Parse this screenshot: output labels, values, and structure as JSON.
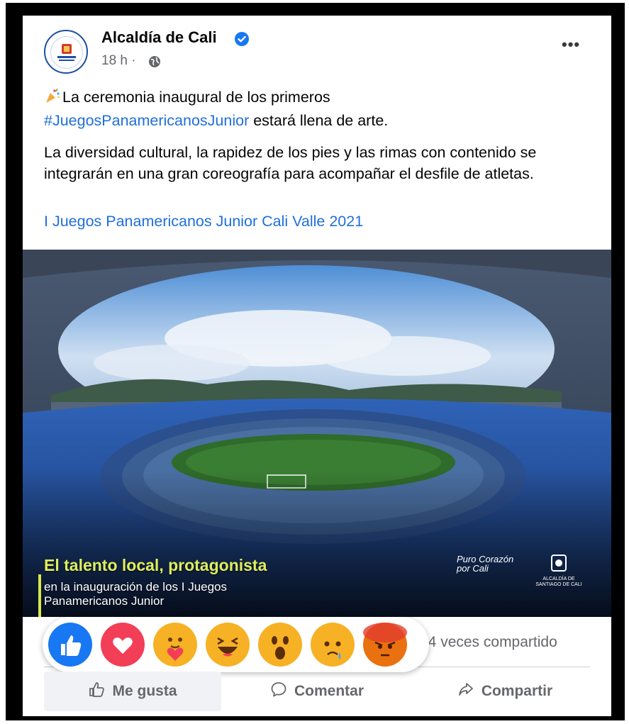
{
  "post": {
    "page_name": "Alcaldía de Cali",
    "time": "18 h ·",
    "more": "•••",
    "text_line1_prefix": "La ceremonia inaugural de los primeros",
    "hashtag": "#JuegosPanamericanosJunior",
    "text_line2_suffix": " estará llena de arte.",
    "paragraph2": "La diversidad cultural, la rapidez de los pies y las rimas con contenido se integrarán en una gran coreografía para acompañar el desfile de atletas.",
    "event_link": "I Juegos Panamericanos Junior Cali Valle 2021"
  },
  "photo": {
    "title": "El talento local, protagonista",
    "subtitle": "en la inauguración de los I Juegos Panamericanos Junior",
    "brand_left": "Puro Corazón por Cali",
    "brand_right": "ALCALDÍA DE SANTIAGO DE CALI"
  },
  "stats": {
    "shares": "24 veces compartido"
  },
  "reactions": [
    {
      "name": "like",
      "color": "#1877f2"
    },
    {
      "name": "love",
      "color": "#f33e58"
    },
    {
      "name": "care",
      "color": "#f7b125"
    },
    {
      "name": "haha",
      "color": "#f7b125"
    },
    {
      "name": "wow",
      "color": "#f7b125"
    },
    {
      "name": "sad",
      "color": "#f7b125"
    },
    {
      "name": "angry",
      "color": "#e9710f"
    }
  ],
  "actions": {
    "like": "Me gusta",
    "comment": "Comentar",
    "share": "Compartir"
  },
  "colors": {
    "link": "#216fdb",
    "secondary_text": "#65676b",
    "verified": "#1877f2"
  }
}
